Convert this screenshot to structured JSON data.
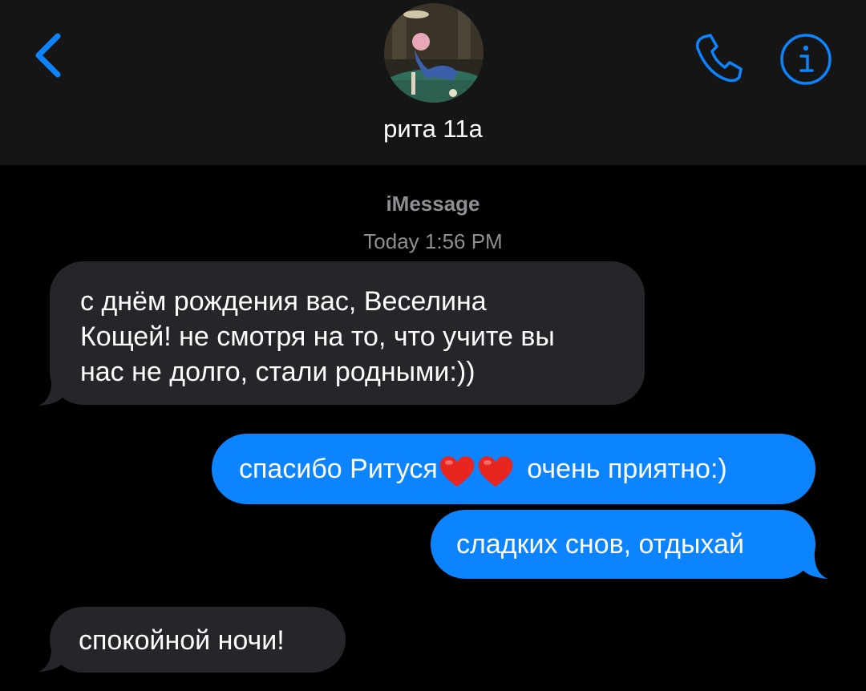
{
  "header": {
    "contact_name": "рита 11а",
    "back_icon": "chevron-left-icon",
    "call_icon": "phone-icon",
    "info_icon": "info-icon",
    "accent_color": "#0b84fe"
  },
  "thread": {
    "service_label": "iMessage",
    "timestamp": "Today 1:56 PM"
  },
  "messages": [
    {
      "direction": "incoming",
      "lines": [
        "с днём рождения вас, Веселина",
        "Кощей! не смотря на то, что учите вы",
        "нас не долго, стали родными:))"
      ]
    },
    {
      "direction": "outgoing",
      "text_before": "спасибо Ритуся",
      "emoji": "❤️❤️",
      "text_after": " очень приятно:)"
    },
    {
      "direction": "outgoing",
      "text": "сладких снов, отдыхай"
    },
    {
      "direction": "incoming",
      "text": "спокойной ночи!"
    }
  ],
  "colors": {
    "incoming_bubble": "#26252a",
    "outgoing_bubble": "#0b84fe",
    "header_bg": "#151515",
    "meta_text": "#8e8e93"
  }
}
